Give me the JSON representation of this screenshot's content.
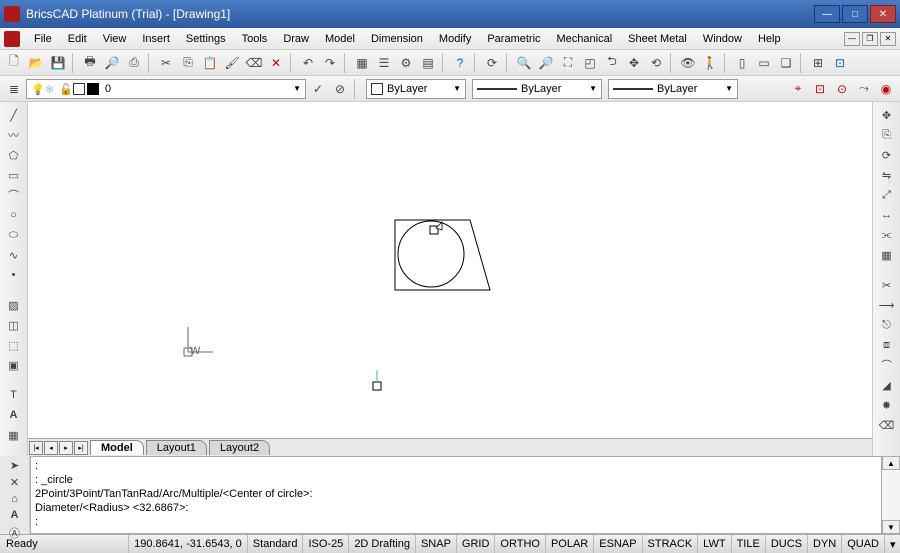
{
  "title": "BricsCAD Platinum (Trial) - [Drawing1]",
  "menu": [
    "File",
    "Edit",
    "View",
    "Insert",
    "Settings",
    "Tools",
    "Draw",
    "Model",
    "Dimension",
    "Modify",
    "Parametric",
    "Mechanical",
    "Sheet Metal",
    "Window",
    "Help"
  ],
  "layer": {
    "name": "0"
  },
  "props": {
    "color": "ByLayer",
    "linetype": "ByLayer",
    "lineweight": "ByLayer"
  },
  "tabs": {
    "model": "Model",
    "layout1": "Layout1",
    "layout2": "Layout2"
  },
  "cmd": {
    "l1": ":",
    "l2": ": _circle",
    "l3": "2Point/3Point/TanTanRad/Arc/Multiple/<Center of circle>:",
    "l4": "Diameter/<Radius> <32.6867>:",
    "l5": ":"
  },
  "status": {
    "ready": "Ready",
    "coords": "190.8641, -31.6543, 0",
    "style": "Standard",
    "iso": "ISO-25",
    "mode": "2D Drafting",
    "toggles": [
      "SNAP",
      "GRID",
      "ORTHO",
      "POLAR",
      "ESNAP",
      "STRACK",
      "LWT",
      "TILE",
      "DUCS",
      "DYN",
      "QUAD"
    ]
  }
}
